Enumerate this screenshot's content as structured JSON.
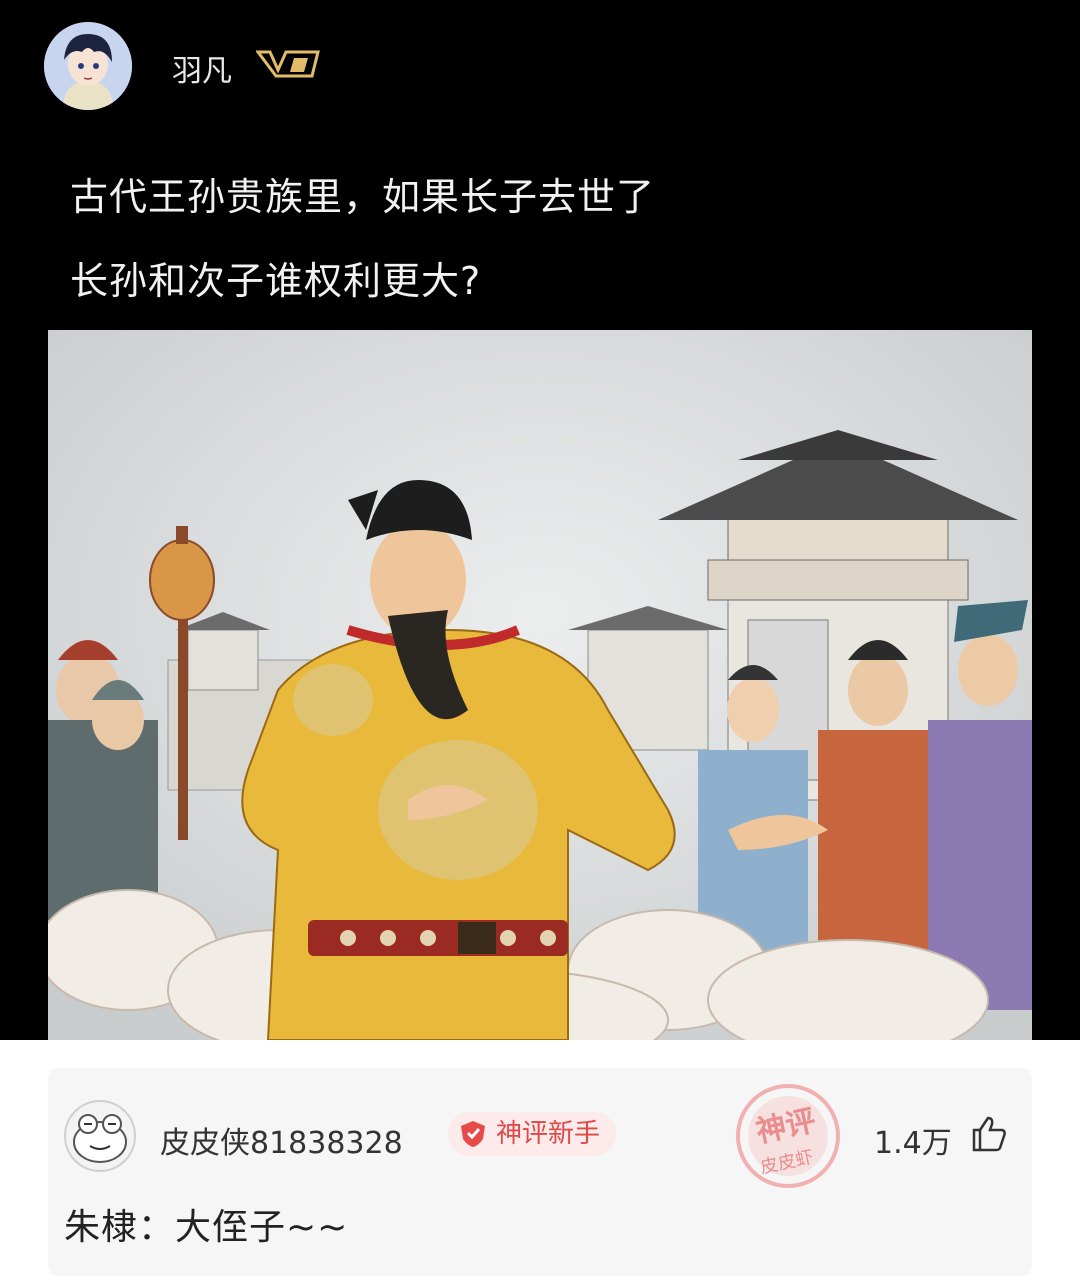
{
  "post": {
    "author": "羽凡",
    "vip_badge_icon": "vip-v-icon",
    "lines": [
      "古代王孙贵族里，如果长子去世了",
      "长孙和次子谁权利更大?"
    ],
    "image": "ancient-emperor-illustration"
  },
  "comment": {
    "username": "皮皮侠81838328",
    "badge_label": "神评新手",
    "stamp_texts": [
      "神评",
      "皮皮虾"
    ],
    "likes": "1.4万",
    "text": "朱棣：大侄子~~"
  },
  "colors": {
    "post_bg": "#000000",
    "badge_text": "#e04848",
    "stamp": "#e67a7a",
    "robe_yellow": "#e8b93a"
  }
}
